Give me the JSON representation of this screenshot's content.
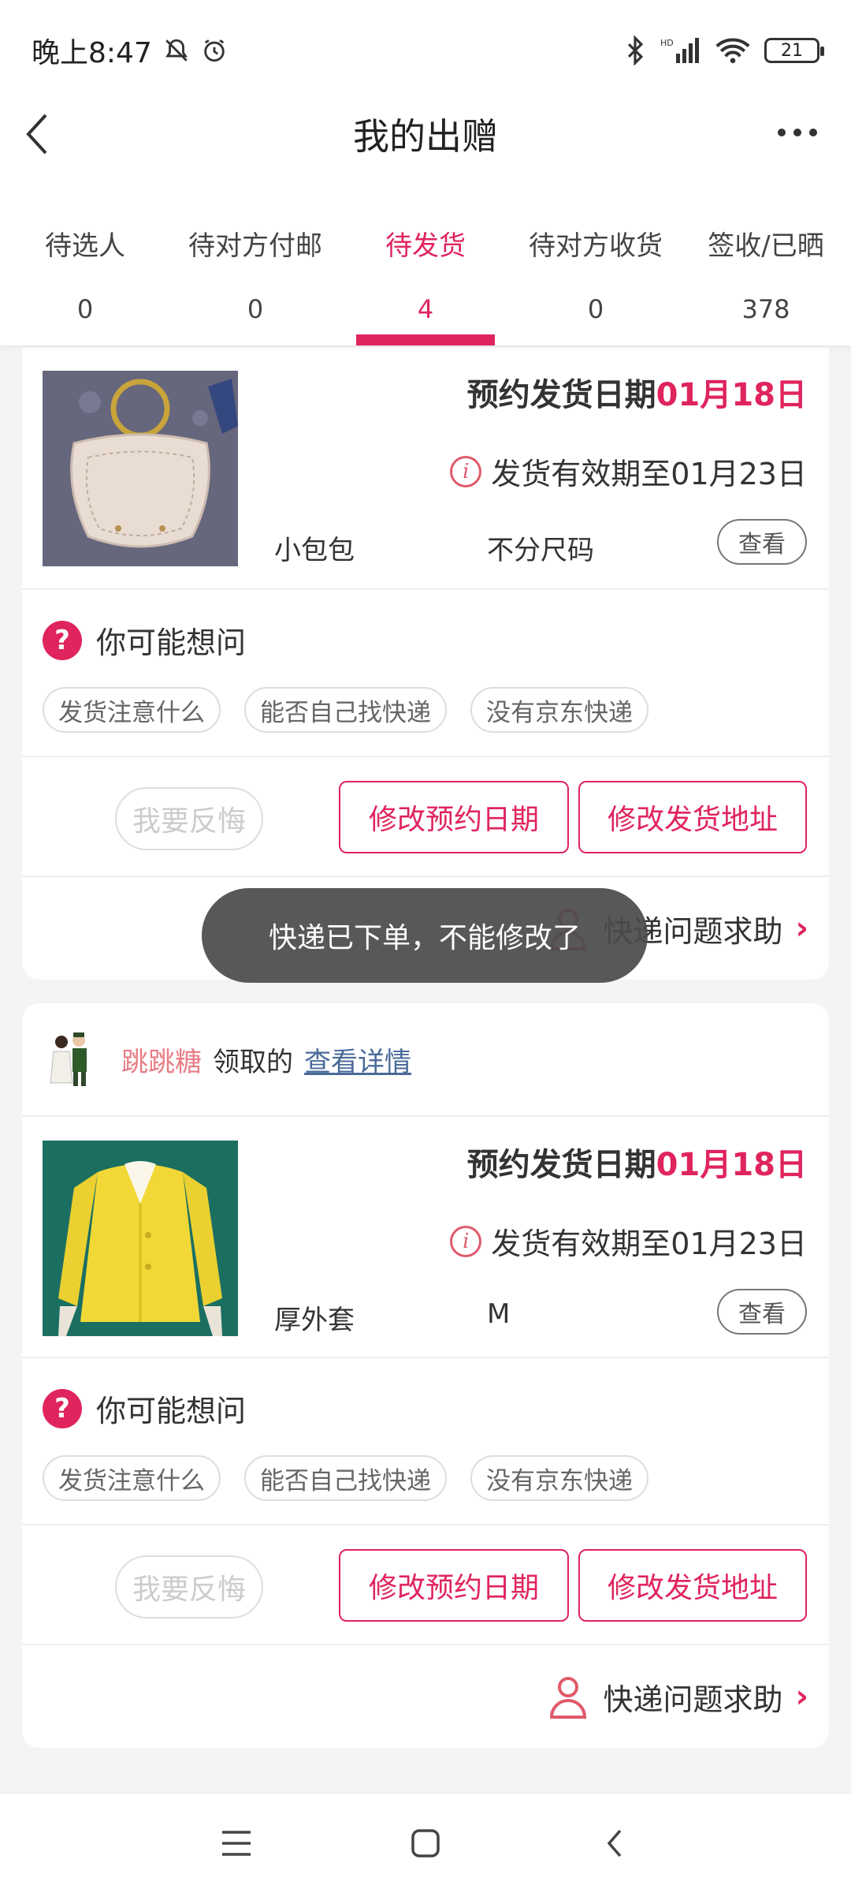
{
  "status_bar": {
    "time": "晚上8:47",
    "battery": "21"
  },
  "header": {
    "title": "我的出赠"
  },
  "tabs": [
    {
      "label": "待选人",
      "count": "0"
    },
    {
      "label": "待对方付邮",
      "count": "0"
    },
    {
      "label": "待发货",
      "count": "4"
    },
    {
      "label": "待对方收货",
      "count": "0"
    },
    {
      "label": "签收/已晒",
      "count": "378"
    }
  ],
  "active_tab": 2,
  "cards": [
    {
      "ship_label": "预约发货日期",
      "ship_date": "01月18日",
      "validity": "发货有效期至01月23日",
      "product_name": "小包包",
      "product_size": "不分尺码",
      "view_label": "查看",
      "faq_title": "你可能想问",
      "chips": [
        "发货注意什么",
        "能否自己找快递",
        "没有京东快递"
      ],
      "regret_label": "我要反悔",
      "change_date_label": "修改预约日期",
      "change_address_label": "修改发货地址",
      "help_label": "快递问题求助"
    },
    {
      "username": "跳跳糖",
      "claimed_text": "领取的",
      "detail_link": "查看详情",
      "ship_label": "预约发货日期",
      "ship_date": "01月18日",
      "validity": "发货有效期至01月23日",
      "product_name": "厚外套",
      "product_size": "M",
      "view_label": "查看",
      "faq_title": "你可能想问",
      "chips": [
        "发货注意什么",
        "能否自己找快递",
        "没有京东快递"
      ],
      "regret_label": "我要反悔",
      "change_date_label": "修改预约日期",
      "change_address_label": "修改发货地址",
      "help_label": "快递问题求助"
    }
  ],
  "toast": "快递已下单，不能修改了",
  "colors": {
    "accent": "#e0245e",
    "username": "#e87d86",
    "link": "#4a6a9a"
  }
}
